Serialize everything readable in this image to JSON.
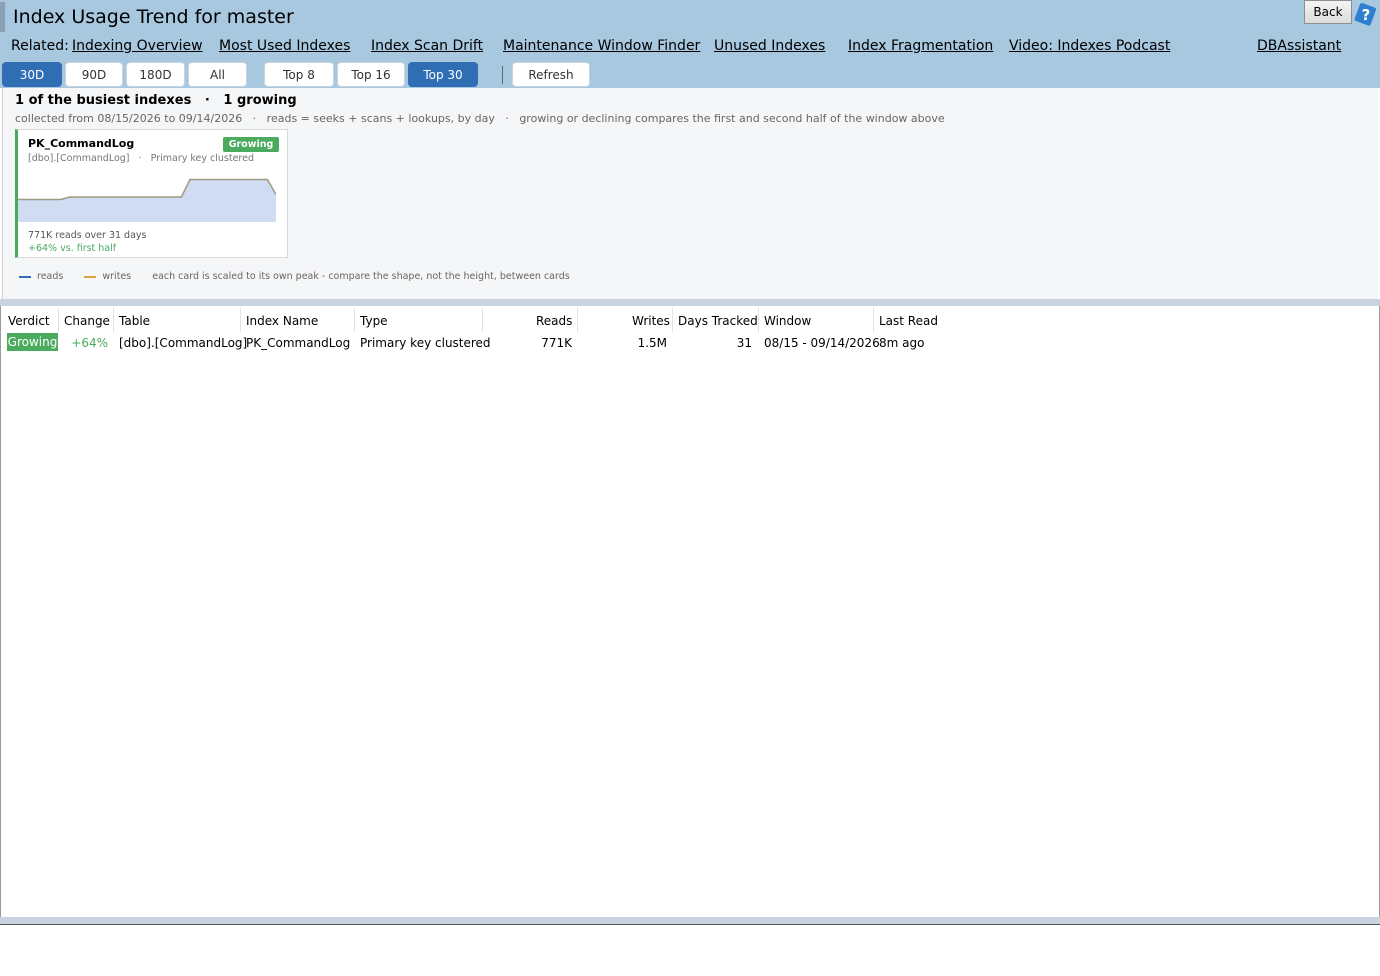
{
  "header": {
    "title": "Index Usage Trend for master",
    "back_label": "Back",
    "related_label": "Related:",
    "links": [
      "Indexing Overview",
      "Most Used Indexes",
      "Index Scan Drift",
      "Maintenance Window Finder",
      "Unused Indexes",
      "Index Fragmentation",
      "Video: Indexes Podcast",
      "DBAssistant"
    ]
  },
  "toolbar": {
    "range_buttons": [
      "30D",
      "90D",
      "180D",
      "All"
    ],
    "top_buttons": [
      "Top 8",
      "Top 16",
      "Top 30"
    ],
    "refresh_label": "Refresh",
    "active_range": "30D",
    "active_top": "Top 30"
  },
  "summary": {
    "headline": "1 of the busiest indexes   ·   1 growing",
    "collected": "collected from 08/15/2026 to 09/14/2026   ·   reads = seeks + scans + lookups, by day   ·   growing or declining compares the first and second half of the window above"
  },
  "card": {
    "index_name": "PK_CommandLog",
    "badge": "Growing",
    "subtitle": "[dbo].[CommandLog]   ·   Primary key clustered",
    "reads_text": "771K reads over 31 days",
    "change_text": "+64% vs. first half",
    "sparkline": [
      0.45,
      0.45,
      0.45,
      0.45,
      0.45,
      0.45,
      0.5,
      0.5,
      0.5,
      0.5,
      0.5,
      0.5,
      0.5,
      0.5,
      0.5,
      0.5,
      0.5,
      0.5,
      0.5,
      0.5,
      0.85,
      0.85,
      0.85,
      0.85,
      0.85,
      0.85,
      0.85,
      0.85,
      0.85,
      0.85,
      0.55
    ],
    "color": "#7a9cc6"
  },
  "legend": {
    "reads": "reads",
    "writes": "writes",
    "note": "each card is scaled to its own peak - compare the shape, not the height, between cards",
    "reads_color": "#2f6db5",
    "writes_color": "#e0a040"
  },
  "table": {
    "headers": [
      "Verdict",
      "Change",
      "Table",
      "Index Name",
      "Type",
      "Reads",
      "Writes",
      "Days Tracked",
      "Window",
      "Last Read"
    ],
    "rows": [
      {
        "verdict": "Growing",
        "change": "+64%",
        "table": "[dbo].[CommandLog]",
        "index_name": "PK_CommandLog",
        "type": "Primary key clustered",
        "reads": "771K",
        "writes": "1.5M",
        "days_tracked": "31",
        "window": "08/15 - 09/14/2026",
        "last_read": "8m ago"
      }
    ]
  },
  "colors": {
    "header_bg": "#a8c8e0",
    "active_button": "#2f6db5",
    "growing": "#4aaa5e"
  }
}
